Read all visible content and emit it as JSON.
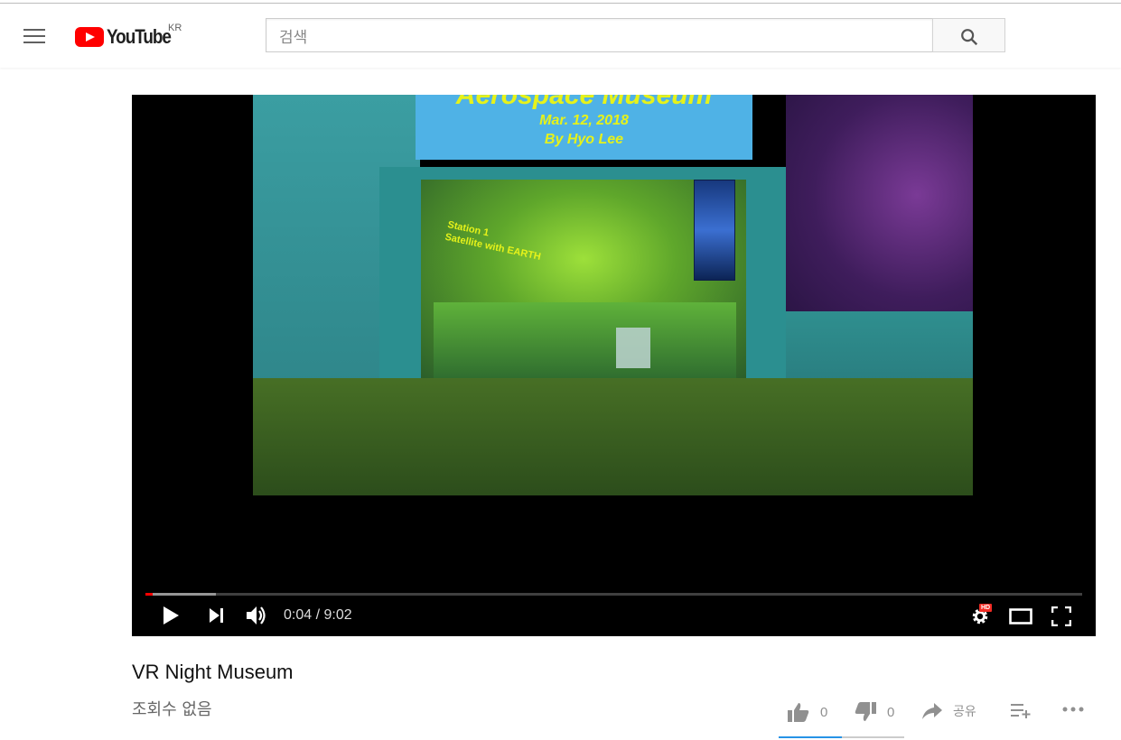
{
  "masthead": {
    "logo_text": "YouTube",
    "country_code": "KR",
    "search_placeholder": "검색"
  },
  "video_frame": {
    "sign_title": "Aerospace Museum",
    "sign_date": "Mar. 12, 2018",
    "sign_author": "By Hyo Lee",
    "station_line1": "Station 1",
    "station_line2": "Satellite with EARTH"
  },
  "player": {
    "current_time": "0:04",
    "duration": "9:02",
    "time_display": "0:04 / 9:02",
    "progress_played_fraction": 0.0074,
    "progress_loaded_fraction": 0.075,
    "quality_badge": "HD"
  },
  "video": {
    "title": "VR Night Museum",
    "views": "조회수 없음",
    "like_count": "0",
    "dislike_count": "0",
    "share_label": "공유",
    "like_fraction": 0.5
  },
  "colors": {
    "brand_red": "#ff0000",
    "progress_red": "#ff0000",
    "sentiment_blue": "#2793e6"
  }
}
